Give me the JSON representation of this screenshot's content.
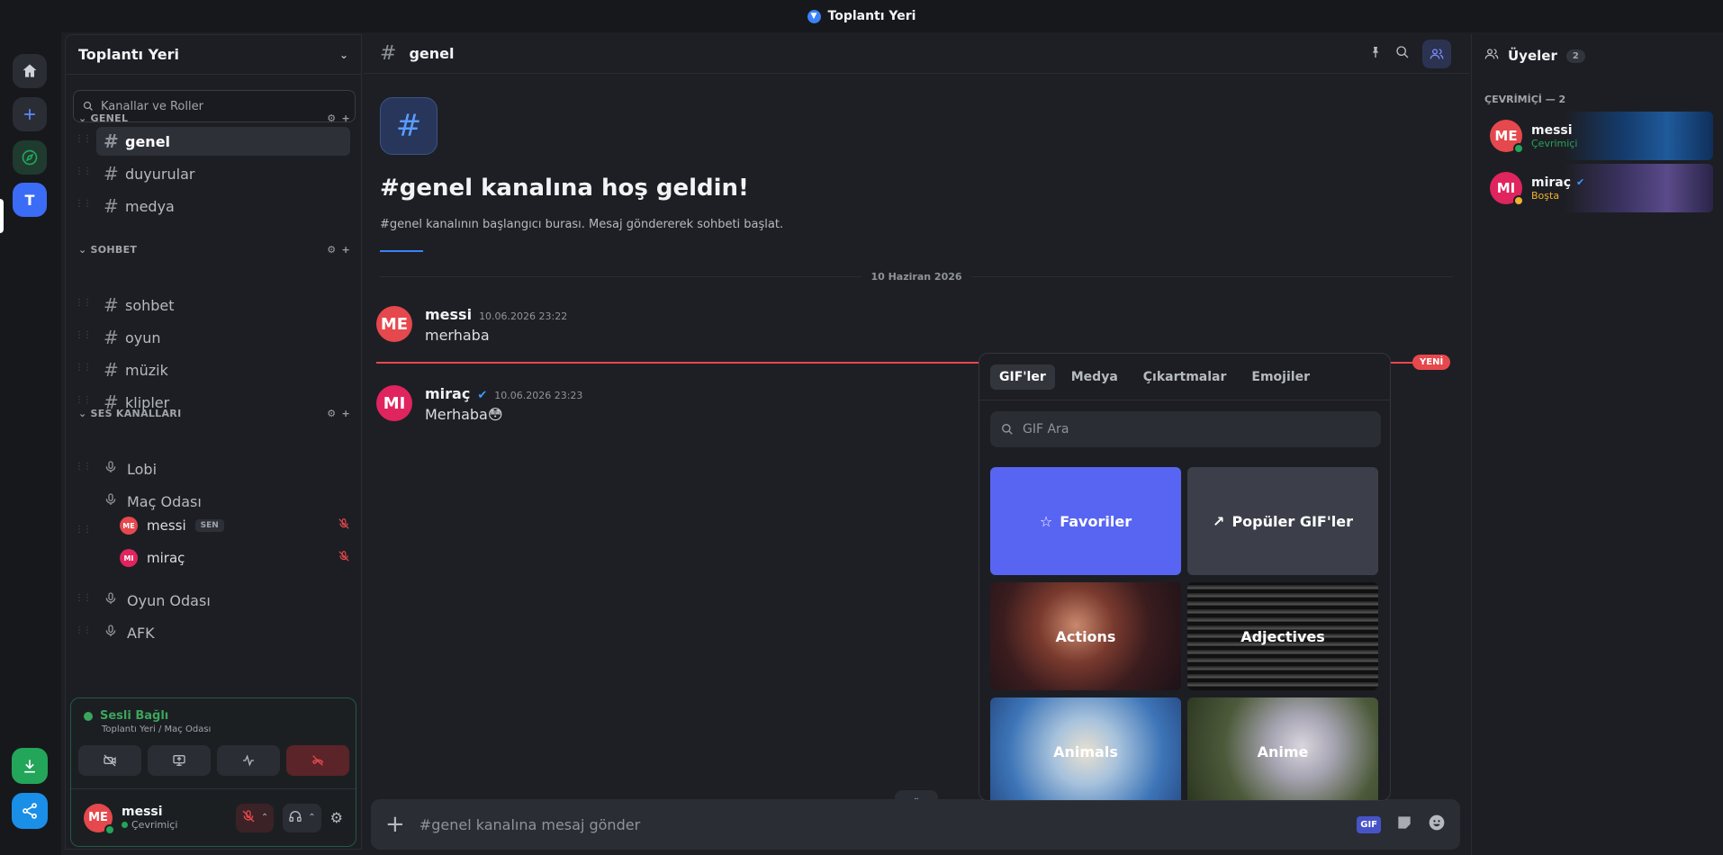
{
  "window": {
    "title": "Toplantı Yeri"
  },
  "rail": {
    "server_initial": "T"
  },
  "server": {
    "name": "Toplantı Yeri",
    "search_placeholder": "Kanallar ve Roller"
  },
  "categories": [
    {
      "label": "GENEL",
      "channels": [
        "genel",
        "duyurular",
        "medya"
      ]
    },
    {
      "label": "SOHBET",
      "channels": [
        "sohbet",
        "oyun",
        "müzik",
        "klipler"
      ]
    },
    {
      "label": "SES KANALLARI",
      "channels": [
        "Lobi",
        "Maç Odası",
        "Oyun Odası",
        "AFK"
      ]
    }
  ],
  "voice_users": [
    {
      "initials": "ME",
      "name": "messi",
      "badge": "SEN",
      "color": "#e5484d"
    },
    {
      "initials": "MI",
      "name": "miraç",
      "color": "#e0245e"
    }
  ],
  "voice_panel": {
    "status": "Sesli Bağlı",
    "location": "Toplantı Yeri / Maç Odası"
  },
  "current_user": {
    "initials": "ME",
    "name": "messi",
    "status": "Çevrimiçi"
  },
  "channel": {
    "name": "genel",
    "welcome_title": "#genel kanalına hoş geldin!",
    "welcome_sub": "#genel kanalının başlangıcı burası. Mesaj göndererek sohbeti başlat.",
    "date_divider": "10 Haziran 2026",
    "new_badge": "YENİ",
    "composer_placeholder": "#genel kanalına mesaj gönder"
  },
  "messages": [
    {
      "initials": "ME",
      "author": "messi",
      "time": "10.06.2026 23:22",
      "text": "merhaba",
      "color": "#e5484d"
    },
    {
      "initials": "MI",
      "author": "miraç",
      "time": "10.06.2026 23:23",
      "text": "Merhaba",
      "emoji": "😳",
      "color": "#e0245e"
    }
  ],
  "gif_picker": {
    "tabs": [
      "GIF'ler",
      "Medya",
      "Çıkartmalar",
      "Emojiler"
    ],
    "search_placeholder": "GIF Ara",
    "tiles": [
      "Favoriler",
      "Popüler GIF'ler",
      "Actions",
      "Adjectives",
      "Animals",
      "Anime"
    ]
  },
  "members": {
    "title": "Üyeler",
    "count": "2",
    "online_header": "ÇEVRİMİÇİ — 2",
    "list": [
      {
        "initials": "ME",
        "name": "messi",
        "status": "Çevrimiçi",
        "color": "#e5484d",
        "status_color": "#23a55a"
      },
      {
        "initials": "MI",
        "name": "miraç",
        "status": "Boşta",
        "color": "#e0245e",
        "status_color": "#f0b232"
      }
    ]
  },
  "composer": {
    "gif_label": "GIF"
  }
}
